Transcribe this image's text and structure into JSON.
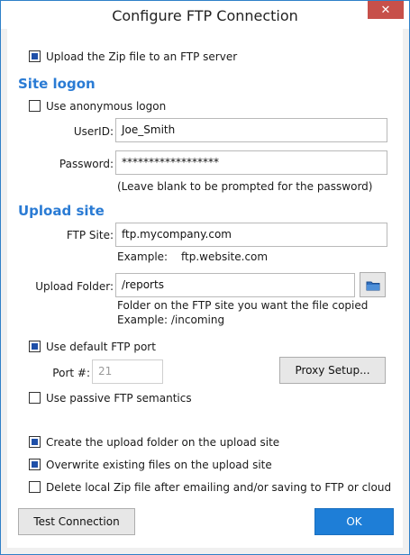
{
  "window": {
    "title": "Configure FTP Connection",
    "close_glyph": "✕"
  },
  "upload_zip": {
    "label": "Upload the Zip file to an FTP server",
    "checked": true
  },
  "site_logon": {
    "heading": "Site logon",
    "anonymous": {
      "label": "Use anonymous logon",
      "checked": false
    },
    "userid": {
      "label": "UserID:",
      "value": "Joe_Smith"
    },
    "password": {
      "label": "Password:",
      "value": "******************"
    },
    "password_hint": "(Leave blank to be prompted for the password)"
  },
  "upload_site": {
    "heading": "Upload site",
    "ftp_site": {
      "label": "FTP Site:",
      "value": "ftp.mycompany.com"
    },
    "example_label": "Example:",
    "example_value": "ftp.website.com",
    "upload_folder": {
      "label": "Upload Folder:",
      "value": "/reports"
    },
    "folder_hint_1": "Folder on the FTP site you want the file copied",
    "folder_hint_2": "Example:  /incoming",
    "default_port": {
      "label": "Use default FTP port",
      "checked": true
    },
    "port": {
      "label": "Port #:",
      "value": "21"
    },
    "proxy_button": "Proxy Setup...",
    "passive": {
      "label": "Use passive FTP semantics",
      "checked": false
    }
  },
  "options": {
    "create_folder": {
      "label": "Create the upload folder on the upload site",
      "checked": true
    },
    "overwrite": {
      "label": "Overwrite existing files on the upload site",
      "checked": true
    },
    "delete_local": {
      "label": "Delete local Zip file after emailing and/or saving to FTP or cloud",
      "checked": false
    }
  },
  "footer": {
    "test_button": "Test Connection",
    "ok_button": "OK"
  },
  "colors": {
    "accent": "#2a7bd4",
    "ok_button": "#1e7ed7",
    "close_button": "#c7504a"
  },
  "icons": {
    "browse": "folder-icon"
  }
}
